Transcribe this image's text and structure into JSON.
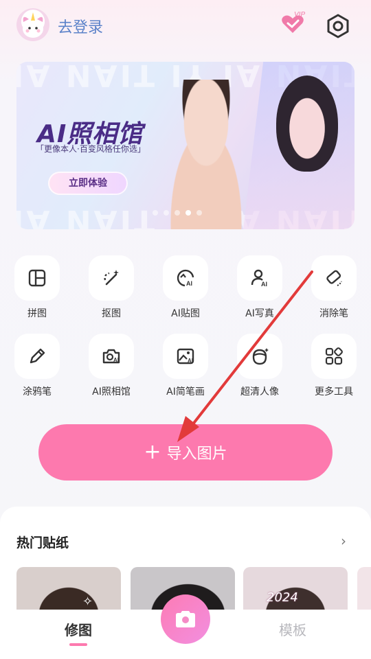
{
  "header": {
    "login_text": "去登录",
    "vip_badge": "VIP"
  },
  "banner": {
    "watermark": "TIAN AI YI TIAN AI",
    "brand": "AI照相馆",
    "tagline": "「更像本人·百变风格任你选」",
    "cta": "立即体验",
    "active_slide": 4,
    "total_slides": 5
  },
  "tools": [
    {
      "label": "拼图",
      "icon": "collage-icon"
    },
    {
      "label": "抠图",
      "icon": "cutout-wand-icon"
    },
    {
      "label": "AI贴图",
      "icon": "ai-sticker-icon"
    },
    {
      "label": "AI写真",
      "icon": "ai-portrait-icon"
    },
    {
      "label": "消除笔",
      "icon": "eraser-icon"
    },
    {
      "label": "涂鸦笔",
      "icon": "pencil-icon"
    },
    {
      "label": "AI照相馆",
      "icon": "ai-camera-icon"
    },
    {
      "label": "AI简笔画",
      "icon": "ai-sketch-image-icon"
    },
    {
      "label": "超清人像",
      "icon": "hd-face-icon"
    },
    {
      "label": "更多工具",
      "icon": "more-tools-grid-icon"
    }
  ],
  "import_button": {
    "label": "导入图片",
    "icon": "plus-icon"
  },
  "stickers": {
    "title": "热门贴纸",
    "more_icon": "chevron-right-icon",
    "thumb3_caption": "2024"
  },
  "bottom_nav": {
    "tab_edit": "修图",
    "tab_template": "模板",
    "camera_icon": "camera-icon"
  },
  "colors": {
    "accent": "#fd79ae",
    "link_blue": "#5b82c9",
    "annotation_red": "#e23a3a"
  }
}
